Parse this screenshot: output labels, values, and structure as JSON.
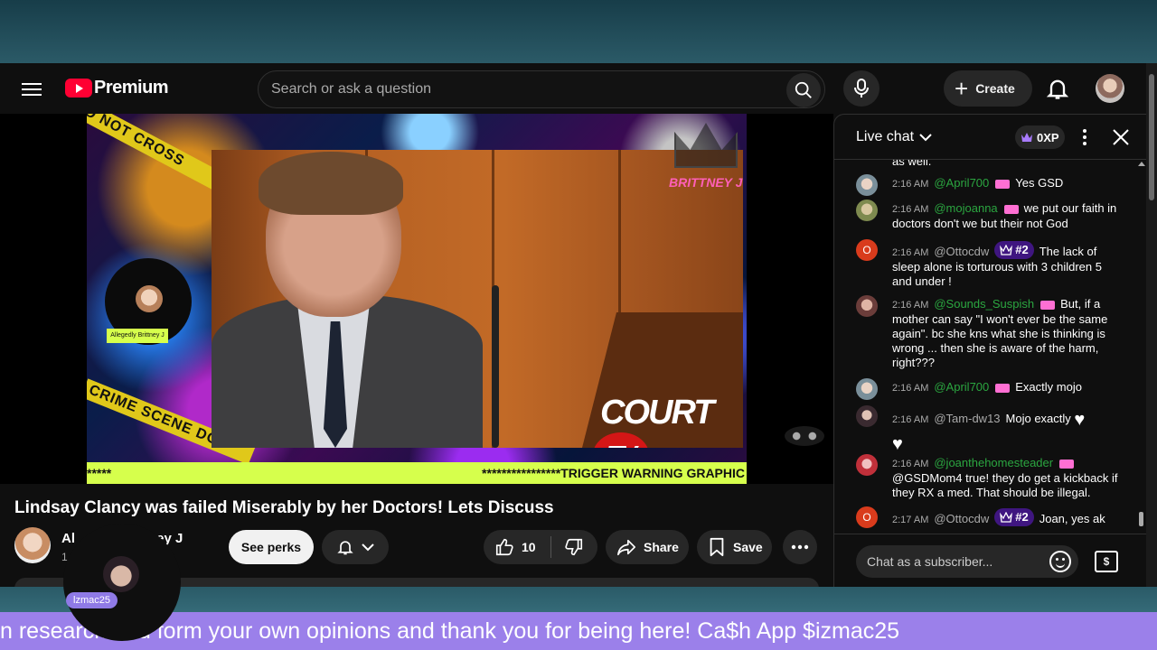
{
  "header": {
    "logo_text": "Premium",
    "search_placeholder": "Search or ask a question",
    "create_label": "Create"
  },
  "video": {
    "overlay_left_tape": "DO NOT CROSS",
    "overlay_bottom_tape": "CRIME SCENE DO",
    "circle_tag": "Allegedly Brittney J",
    "brand_label": "BRITTNEY J",
    "courttv_text": "COURT",
    "courttv_badge": "TV",
    "warning_left": "*****",
    "warning_right": "****************TRIGGER WARNING GRAPHIC"
  },
  "meta": {
    "title": "Lindsay Clancy was failed Miserably by her Doctors! Lets Discuss",
    "channel_name_left": "Al",
    "channel_name_right": "ritney J",
    "channel_subs": "1",
    "perks_label": "See perks",
    "like_count": "10",
    "share_label": "Share",
    "save_label": "Save"
  },
  "chat": {
    "title": "Live chat",
    "xp": "0XP",
    "top_cut_text": "as well.",
    "input_placeholder": "Chat as a subscriber...",
    "messages": [
      {
        "time": "2:16 AM",
        "author": "@April700",
        "rank": "",
        "text": "Yes GSD"
      },
      {
        "time": "2:16 AM",
        "author": "@mojoanna",
        "rank": "",
        "text": "we put our faith in doctors don't we but their not God"
      },
      {
        "time": "2:16 AM",
        "author": "@Ottocdw",
        "rank": "#2",
        "text": "The lack of sleep alone is torturous with 3 children 5 and under !"
      },
      {
        "time": "2:16 AM",
        "author": "@Sounds_Suspish",
        "rank": "",
        "text": "But, if a mother can say \"I won't ever be the same again\". bc she kns what she is thinking is wrong ... then she is aware of the harm, right???"
      },
      {
        "time": "2:16 AM",
        "author": "@April700",
        "rank": "",
        "text": "Exactly mojo"
      },
      {
        "time": "2:16 AM",
        "author": "@Tam-dw13",
        "rank": "",
        "text": "Mojo exactly"
      },
      {
        "time": "2:16 AM",
        "author": "@joanthehomesteader",
        "rank": "",
        "text": "@GSDMom4 true! they do get a kickback if they RX a med. That should be illegal."
      },
      {
        "time": "2:17 AM",
        "author": "@Ottocdw",
        "rank": "#2",
        "text": "Joan, yes ak"
      }
    ]
  },
  "overlay": {
    "cam_tag": "lzmac25",
    "ticker": "n research and form your own opinions and thank you for being here! Ca$h App $izmac25"
  }
}
